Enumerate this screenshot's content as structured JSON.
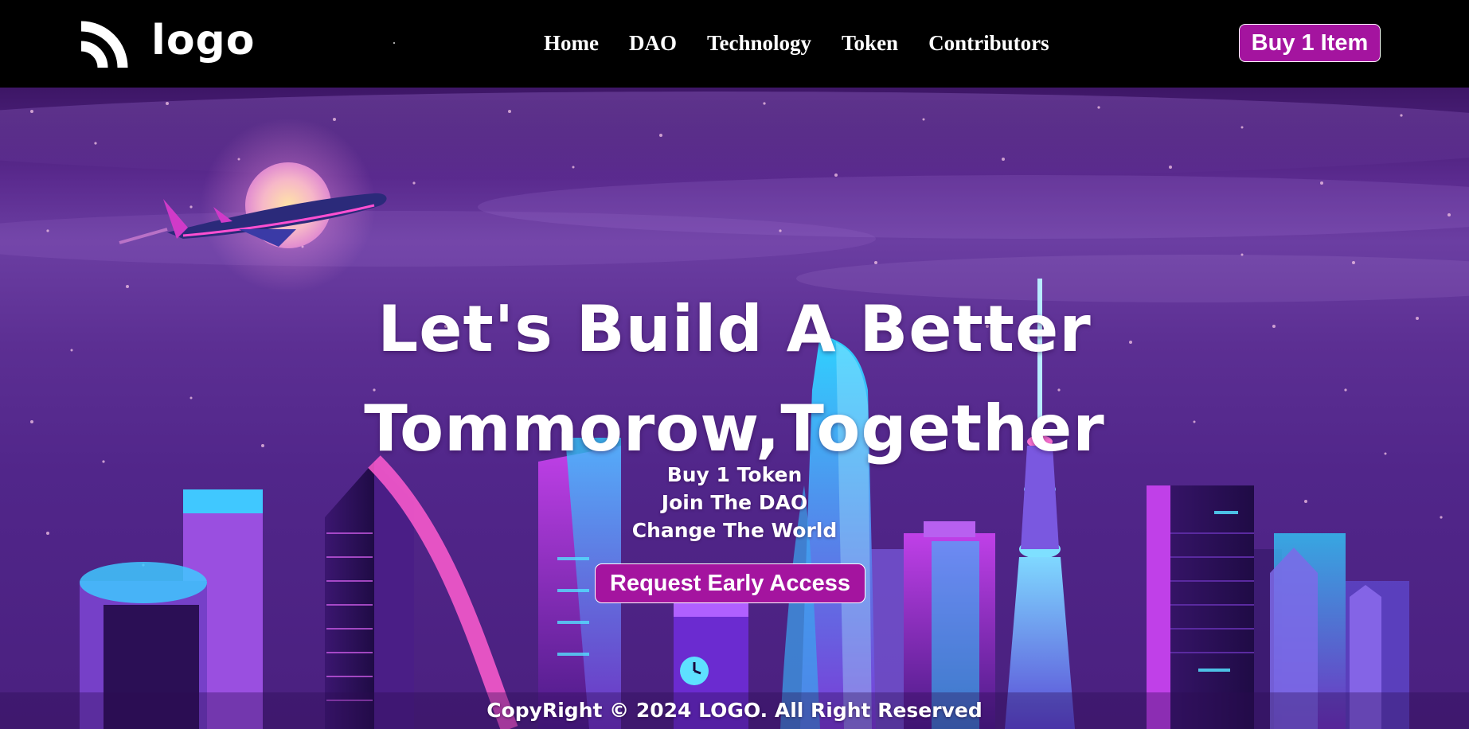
{
  "nav": {
    "logo_text": "logo",
    "links": [
      "Home",
      "DAO",
      "Technology",
      "Token",
      "Contributors"
    ],
    "buy_button": "Buy 1 Item"
  },
  "hero": {
    "headline_line1": "Let's Build A Better",
    "headline_line2": "Tommorow,Together",
    "taglines": [
      "Buy 1 Token",
      "Join The DAO",
      "Change The World"
    ],
    "cta_label": "Request Early Access"
  },
  "footer": {
    "copyright": "CopyRight © 2024 LOGO. All Right Reserved"
  },
  "colors": {
    "brand": "#a4149f",
    "navbar_bg": "#000000",
    "sky": "#5a2a8e"
  },
  "icons": {
    "logo_mark": "wifi-arcs-icon"
  }
}
